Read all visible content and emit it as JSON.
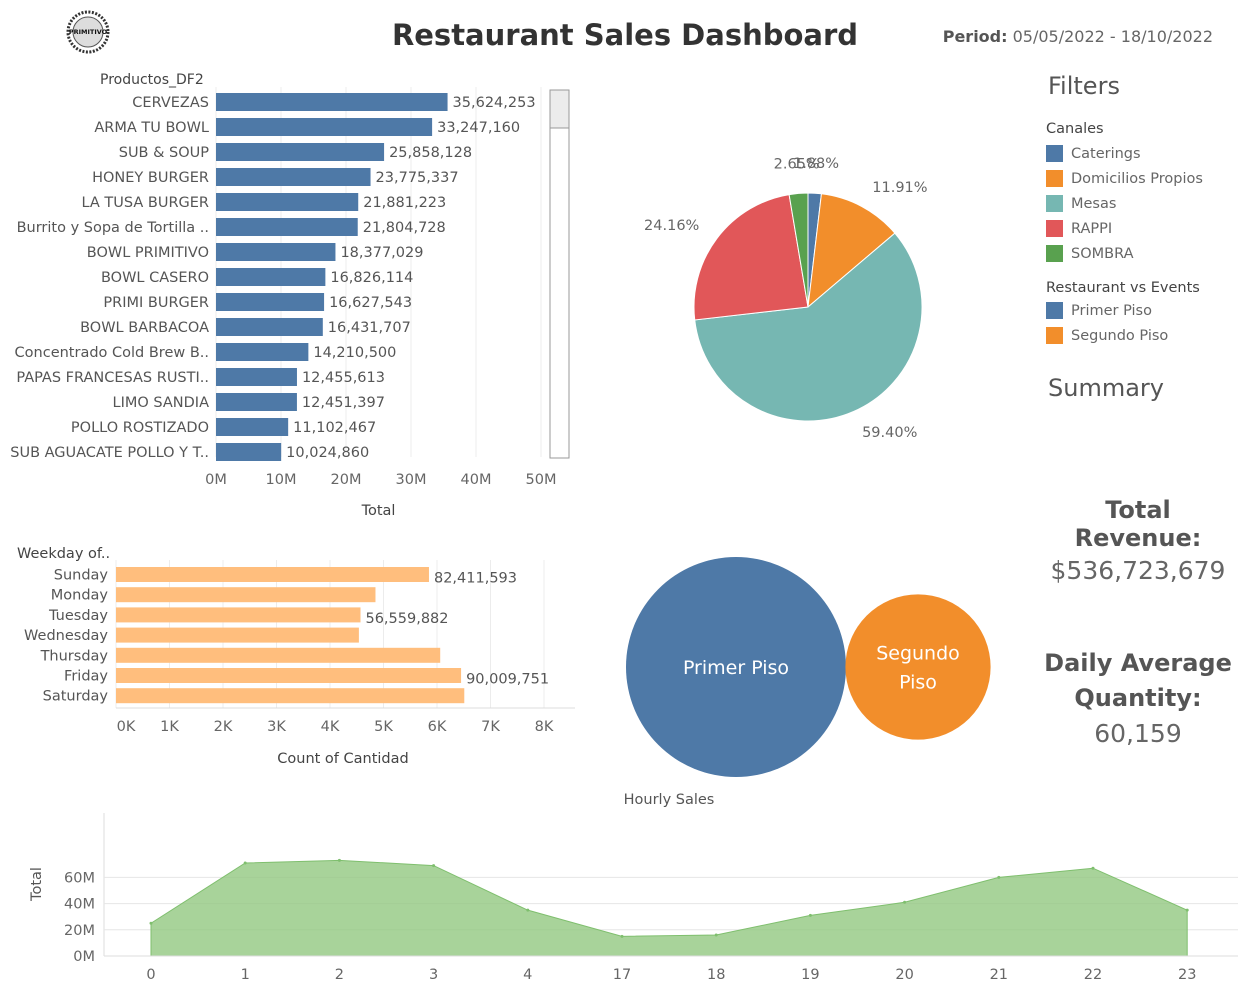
{
  "header": {
    "title": "Restaurant Sales Dashboard",
    "period_label": "Period:",
    "period_value": "05/05/2022 - 18/10/2022",
    "logo_text": "PRIMITIVO"
  },
  "filters": {
    "title": "Filters",
    "canales": {
      "title": "Canales",
      "items": [
        {
          "label": "Caterings",
          "color": "#4e79a7"
        },
        {
          "label": "Domicilios Propios",
          "color": "#f28e2b"
        },
        {
          "label": "Mesas",
          "color": "#76b7b2"
        },
        {
          "label": "RAPPI",
          "color": "#e15759"
        },
        {
          "label": "SOMBRA",
          "color": "#59a14f"
        }
      ]
    },
    "rve": {
      "title": "Restaurant vs Events",
      "items": [
        {
          "label": "Primer Piso",
          "color": "#4e79a7"
        },
        {
          "label": "Segundo Piso",
          "color": "#f28e2b"
        }
      ]
    }
  },
  "summary": {
    "title": "Summary",
    "total_revenue_label": "Total Revenue:",
    "total_revenue_value": "$536,723,679",
    "daily_avg_label_1": "Daily Average",
    "daily_avg_label_2": "Quantity:",
    "daily_avg_value": "60,159"
  },
  "chart_data": [
    {
      "id": "products",
      "type": "bar",
      "orientation": "horizontal",
      "ylabel": "Productos_DF2",
      "xlabel": "Total",
      "color": "#4e79a7",
      "xlim": [
        0,
        55000000
      ],
      "xticks": [
        0,
        10000000,
        20000000,
        30000000,
        40000000,
        50000000
      ],
      "xtick_labels": [
        "0M",
        "10M",
        "20M",
        "30M",
        "40M",
        "50M"
      ],
      "categories": [
        "CERVEZAS",
        "ARMA TU BOWL",
        "SUB & SOUP",
        "HONEY BURGER",
        "LA TUSA BURGER",
        "Burrito y Sopa de Tortilla ..",
        "BOWL PRIMITIVO",
        "BOWL CASERO",
        "PRIMI BURGER",
        "BOWL BARBACOA",
        "Concentrado Cold Brew B..",
        "PAPAS FRANCESAS RUSTI..",
        "LIMO SANDIA",
        "POLLO ROSTIZADO",
        "SUB AGUACATE POLLO Y T.."
      ],
      "values": [
        35624253,
        33247160,
        25858128,
        23775337,
        21881223,
        21804728,
        18377029,
        16826114,
        16627543,
        16431707,
        14210500,
        12455613,
        12451397,
        11102467,
        10024860
      ],
      "value_labels": [
        "35,624,253",
        "33,247,160",
        "25,858,128",
        "23,775,337",
        "21,881,223",
        "21,804,728",
        "18,377,029",
        "16,826,114",
        "16,627,543",
        "16,431,707",
        "14,210,500",
        "12,455,613",
        "12,451,397",
        "11,102,467",
        "10,024,860"
      ]
    },
    {
      "id": "channels",
      "type": "pie",
      "categories": [
        "Caterings",
        "Domicilios Propios",
        "Mesas",
        "RAPPI",
        "SOMBRA"
      ],
      "values": [
        1.88,
        11.91,
        59.4,
        24.16,
        2.65
      ],
      "value_labels": [
        "1.88%",
        "11.91%",
        "59.40%",
        "24.16%",
        "2.65%"
      ],
      "colors": [
        "#4e79a7",
        "#f28e2b",
        "#76b7b2",
        "#e15759",
        "#59a14f"
      ]
    },
    {
      "id": "weekday",
      "type": "bar",
      "orientation": "horizontal",
      "ylabel": "Weekday of..",
      "xlabel": "Count of Cantidad",
      "color": "#ffbe7d",
      "xlim": [
        0,
        8500
      ],
      "xticks": [
        0,
        1000,
        2000,
        3000,
        4000,
        5000,
        6000,
        7000,
        8000
      ],
      "xtick_labels": [
        "0K",
        "1K",
        "2K",
        "3K",
        "4K",
        "5K",
        "6K",
        "7K",
        "8K"
      ],
      "categories": [
        "Sunday",
        "Monday",
        "Tuesday",
        "Wednesday",
        "Thursday",
        "Friday",
        "Saturday"
      ],
      "values": [
        5850,
        4850,
        4570,
        4540,
        6060,
        6450,
        6510
      ],
      "value_labels": [
        "82,411,593",
        "",
        "56,559,882",
        "",
        "",
        "90,009,751",
        ""
      ]
    },
    {
      "id": "floors",
      "type": "bubble",
      "categories": [
        "Primer Piso",
        "Segundo Piso"
      ],
      "label_lines": [
        [
          "Primer Piso"
        ],
        [
          "Segundo",
          "Piso"
        ]
      ],
      "relative_size": [
        1.0,
        0.66
      ],
      "colors": [
        "#4e79a7",
        "#f28e2b"
      ]
    },
    {
      "id": "hourly",
      "type": "area",
      "title": "Hourly Sales",
      "ylabel": "Total",
      "color": "#8fc77e",
      "ylim": [
        0,
        80000000
      ],
      "yticks": [
        0,
        20000000,
        40000000,
        60000000
      ],
      "ytick_labels": [
        "0M",
        "20M",
        "40M",
        "60M"
      ],
      "categories": [
        "0",
        "1",
        "2",
        "3",
        "4",
        "17",
        "18",
        "19",
        "20",
        "21",
        "22",
        "23"
      ],
      "values": [
        25000000,
        71000000,
        73000000,
        69000000,
        35000000,
        15000000,
        16000000,
        31000000,
        41000000,
        60000000,
        67000000,
        35000000
      ]
    }
  ]
}
